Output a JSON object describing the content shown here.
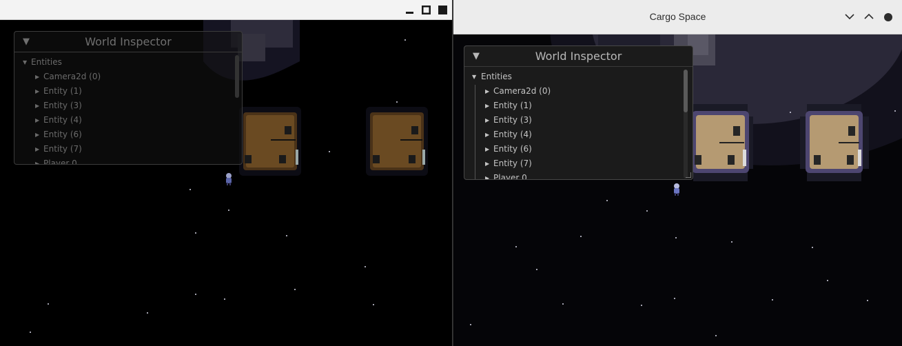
{
  "background_window": {
    "controls": [
      "minimize-icon",
      "maximize-icon",
      "close-icon"
    ],
    "inspector": {
      "title": "World Inspector",
      "root": "Entities",
      "items": [
        "Camera2d (0)",
        "Entity (1)",
        "Entity (3)",
        "Entity (4)",
        "Entity (6)",
        "Entity (7)",
        "Player 0"
      ]
    }
  },
  "main_window": {
    "title": "Cargo Space",
    "controls": [
      "chevron-down-icon",
      "chevron-up-icon",
      "close-icon"
    ],
    "inspector": {
      "title": "World Inspector",
      "root": "Entities",
      "items": [
        "Camera2d (0)",
        "Entity (1)",
        "Entity (3)",
        "Entity (4)",
        "Entity (6)",
        "Entity (7)",
        "Player 0"
      ]
    }
  },
  "colors": {
    "space": "#000000",
    "crate_wood_dim": "#6a4a22",
    "crate_wood_lit": "#b59a72",
    "planet": "#2a2838",
    "titlebar": "#ececec"
  }
}
